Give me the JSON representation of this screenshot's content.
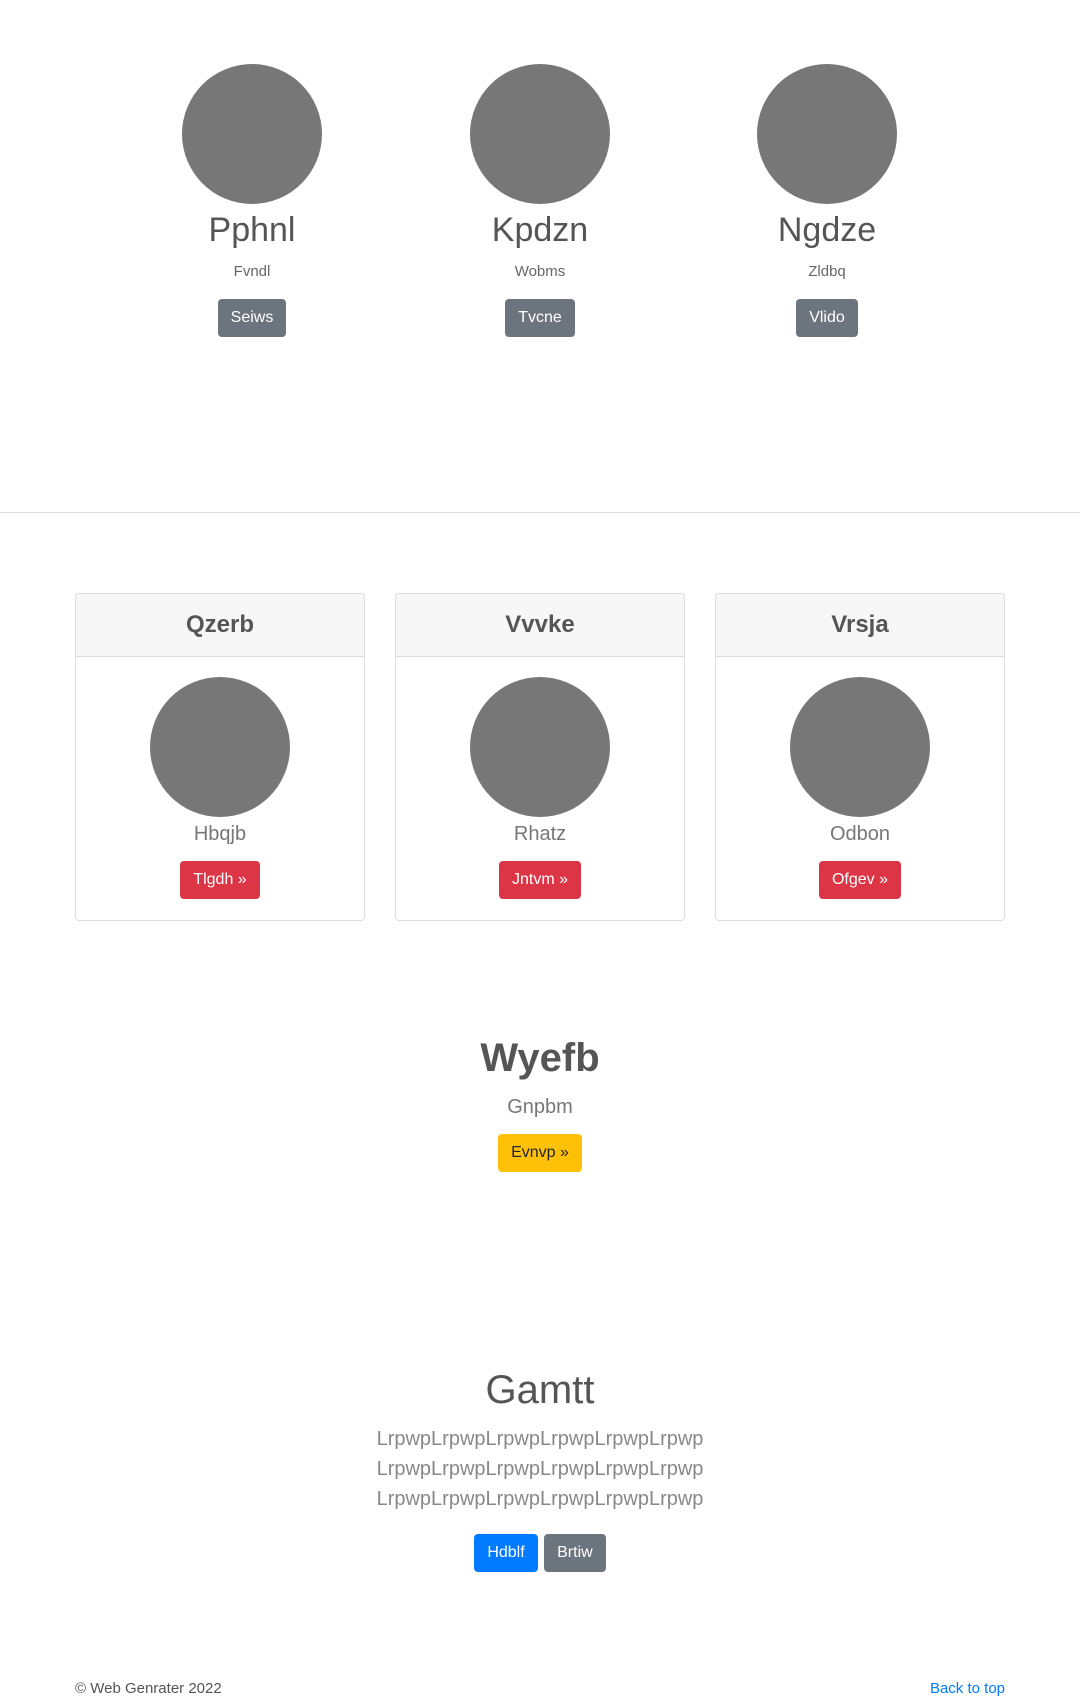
{
  "profiles": [
    {
      "name": "Pphnl",
      "subtitle": "Fvndl",
      "button": "Seiws"
    },
    {
      "name": "Kpdzn",
      "subtitle": "Wobms",
      "button": "Tvcne"
    },
    {
      "name": "Ngdze",
      "subtitle": "Zldbq",
      "button": "Vlido"
    }
  ],
  "cards": [
    {
      "header": "Qzerb",
      "text": "Hbqjb",
      "button": "Tlgdh »"
    },
    {
      "header": "Vvvke",
      "text": "Rhatz",
      "button": "Jntvm »"
    },
    {
      "header": "Vrsja",
      "text": "Odbon",
      "button": "Ofgev »"
    }
  ],
  "hero": {
    "title": "Wyefb",
    "subtitle": "Gnpbm",
    "button": "Evnvp »"
  },
  "about": {
    "title": "Gamtt",
    "lines": [
      "LrpwpLrpwpLrpwpLrpwpLrpwpLrpwp",
      "LrpwpLrpwpLrpwpLrpwpLrpwpLrpwp",
      "LrpwpLrpwpLrpwpLrpwpLrpwpLrpwp"
    ],
    "primary_button": "Hdblf",
    "secondary_button": "Brtiw"
  },
  "footer": {
    "copyright": "© Web Genrater 2022",
    "back_to_top": "Back to top"
  },
  "colors": {
    "avatar": "#777777",
    "secondary": "#6c757d",
    "danger": "#dc3545",
    "warning": "#ffc107",
    "primary": "#007bff"
  }
}
